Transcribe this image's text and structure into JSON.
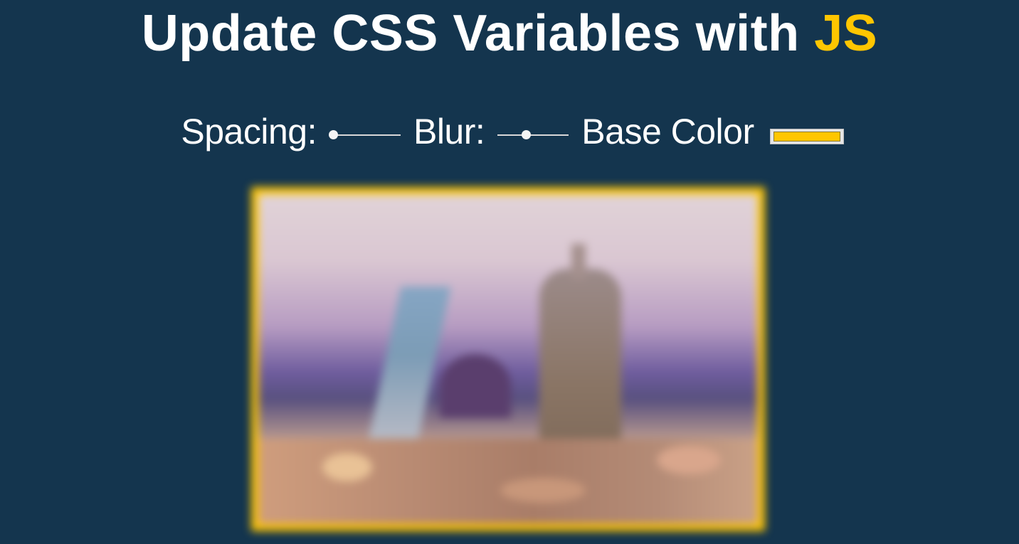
{
  "header": {
    "title_main": "Update CSS Variables with",
    "title_highlight": "JS"
  },
  "controls": {
    "spacing_label": "Spacing:",
    "spacing_value": 0.05,
    "blur_label": "Blur:",
    "blur_value": 0.4,
    "base_color_label": "Base Color",
    "base_color_value": "#ffc600"
  },
  "colors": {
    "background": "#14354e",
    "accent": "#ffc600",
    "text": "#ffffff"
  }
}
